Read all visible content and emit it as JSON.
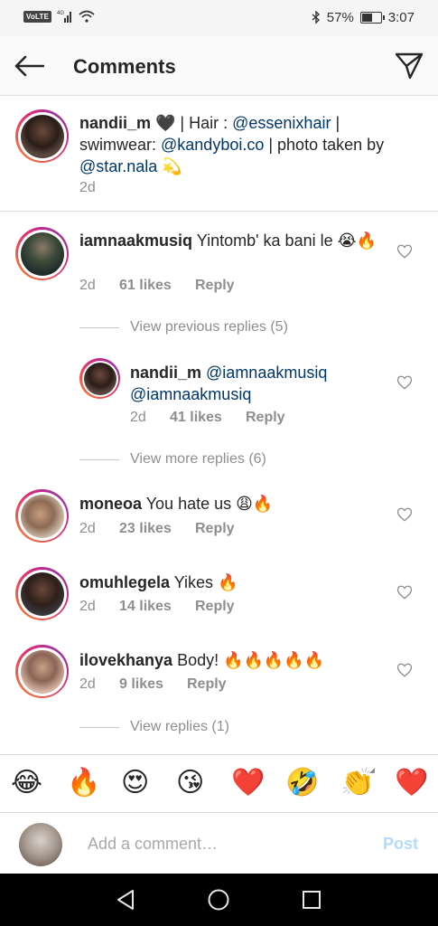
{
  "status_bar": {
    "volte": "VoLTE",
    "network": "4G",
    "battery_percent": "57%",
    "battery_level": 0.57,
    "time": "3:07"
  },
  "header": {
    "title": "Comments",
    "back_icon": "arrow-left-icon",
    "send_icon": "paper-plane-icon"
  },
  "caption": {
    "username": "nandii_m",
    "text_1": " 🖤 | Hair : ",
    "mention_1": "@essenixhair",
    "text_2": " | swimwear: ",
    "mention_2": "@kandyboi.co",
    "text_3": " | photo taken by ",
    "mention_3": "@star.nala",
    "emoji_end": " 💫",
    "time": "2d"
  },
  "comments": [
    {
      "username": "iamnaakmusiq",
      "text": " Yintomb' ka bani le 😭🔥",
      "time": "2d",
      "likes": "61 likes",
      "reply": "Reply",
      "view_replies": "View previous replies (5)"
    },
    {
      "username": "nandii_m",
      "mention_a": "@iamnaakmusiq",
      "mention_b": "@iamnaakmusiq",
      "time": "2d",
      "likes": "41 likes",
      "reply": "Reply",
      "view_replies": "View more replies (6)"
    },
    {
      "username": "moneoa",
      "text": " You hate us 😩🔥",
      "time": "2d",
      "likes": "23 likes",
      "reply": "Reply"
    },
    {
      "username": "omuhlegela",
      "text": " Yikes 🔥",
      "time": "2d",
      "likes": "14 likes",
      "reply": "Reply"
    },
    {
      "username": "ilovekhanya",
      "text": " Body! 🔥🔥🔥🔥🔥",
      "time": "2d",
      "likes": "9 likes",
      "reply": "Reply",
      "view_replies": "View replies (1)"
    }
  ],
  "reactions": [
    "😂",
    "🔥",
    "😍",
    "😘",
    "❤️",
    "🤣",
    "👏",
    "❤️"
  ],
  "composer": {
    "placeholder": "Add a comment…",
    "post_label": "Post"
  },
  "nav": {
    "back": "triangle-back-icon",
    "home": "circle-home-icon",
    "recents": "square-recents-icon"
  },
  "colors": {
    "mention": "#00376b",
    "meta": "#8e8e8e",
    "post_disabled": "#b3dbff",
    "story_ring_start": "#f58529",
    "story_ring_end": "#8134af"
  }
}
